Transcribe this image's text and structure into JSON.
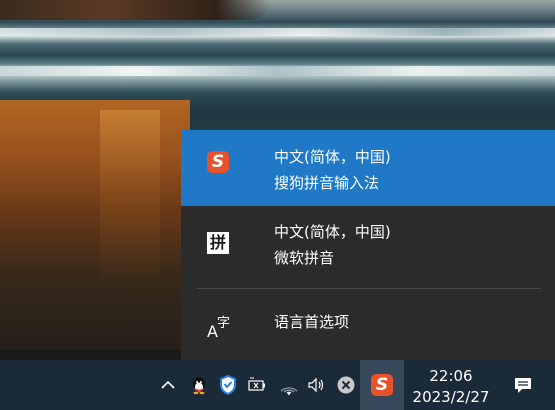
{
  "ime_menu": {
    "items": [
      {
        "line1": "中文(简体，中国)",
        "line2": "搜狗拼音输入法",
        "icon": "sogou-s-icon",
        "icon_text": "S",
        "selected": true
      },
      {
        "line1": "中文(简体，中国)",
        "line2": "微软拼音",
        "icon": "pinyin-icon",
        "icon_text": "拼",
        "selected": false
      },
      {
        "line1": "语言首选项",
        "icon": "language-preferences-icon",
        "icon_text_big": "A",
        "icon_text_small": "字"
      }
    ],
    "highlight_color": "#1f79c6",
    "background_color": "#2b2b2b"
  },
  "taskbar": {
    "tray_icons": [
      "chevron-up-icon",
      "qq-icon",
      "shield-icon",
      "battery-plug-icon",
      "wifi-icon",
      "speaker-icon",
      "close-circle-icon",
      "sogou-tray-icon",
      "notification-icon"
    ],
    "ime_tray_letter": "S",
    "clock_time": "22:06",
    "clock_date": "2023/2/27"
  }
}
